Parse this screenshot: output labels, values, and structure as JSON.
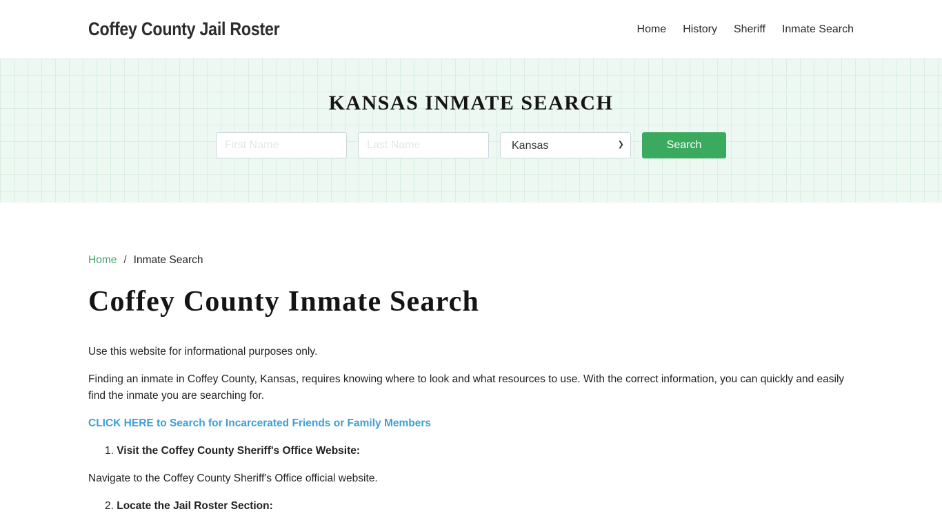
{
  "header": {
    "brand": "Coffey County Jail Roster",
    "nav": [
      {
        "label": "Home"
      },
      {
        "label": "History"
      },
      {
        "label": "Sheriff"
      },
      {
        "label": "Inmate Search"
      }
    ]
  },
  "hero": {
    "title": "KANSAS INMATE SEARCH",
    "first_name_placeholder": "First Name",
    "last_name_placeholder": "Last Name",
    "state_selected": "Kansas",
    "search_label": "Search",
    "accent_color": "#3aaa5e"
  },
  "breadcrumb": {
    "home": "Home",
    "separator": "/",
    "current": "Inmate Search"
  },
  "main": {
    "title": "Coffey County Inmate Search",
    "intro": "Use this website for informational purposes only.",
    "paragraph": "Finding an inmate in Coffey County, Kansas, requires knowing where to look and what resources to use. With the correct information, you can quickly and easily find the inmate you are searching for.",
    "cta_link": "CLICK HERE to Search for Incarcerated Friends or Family Members",
    "steps": [
      {
        "number": "1.",
        "label": "Visit the Coffey County Sheriff's Office Website:",
        "description": "Navigate to the Coffey County Sheriff's Office official website."
      },
      {
        "number": "2.",
        "label": "Locate the Jail Roster Section:"
      }
    ]
  }
}
